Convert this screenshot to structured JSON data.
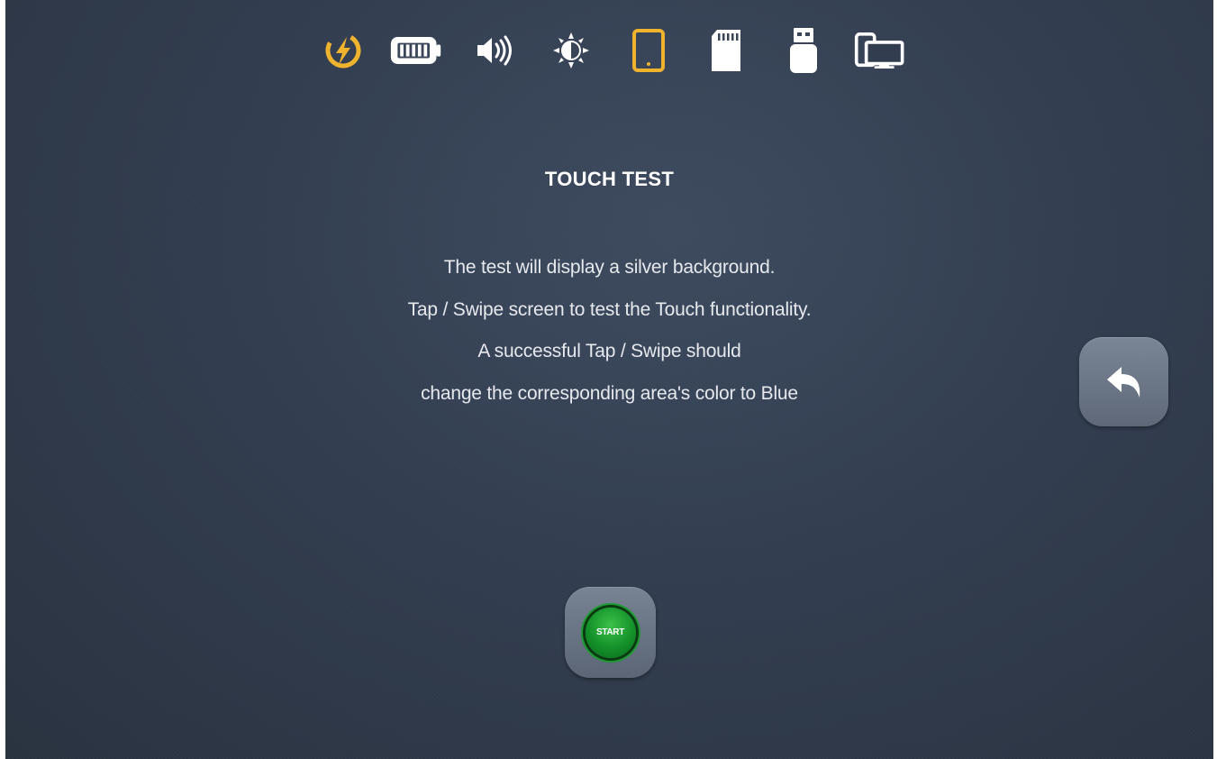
{
  "colors": {
    "accent": "#f0b32e",
    "icon": "#ffffff",
    "background": "#323d50",
    "start_green": "#14912a"
  },
  "toolbar": {
    "icons": [
      {
        "name": "power-icon",
        "active": true
      },
      {
        "name": "battery-icon",
        "active": false
      },
      {
        "name": "volume-icon",
        "active": false
      },
      {
        "name": "brightness-icon",
        "active": false
      },
      {
        "name": "tablet-touch-icon",
        "active": true
      },
      {
        "name": "sd-card-icon",
        "active": false
      },
      {
        "name": "usb-icon",
        "active": false
      },
      {
        "name": "display-output-icon",
        "active": false
      }
    ]
  },
  "main": {
    "title": "TOUCH TEST",
    "lines": [
      "The test will display a silver background.",
      "Tap / Swipe screen to test the Touch functionality.",
      "A successful Tap / Swipe should",
      "change the corresponding area's color to Blue"
    ]
  },
  "back_button": {
    "icon": "back-arrow-icon"
  },
  "start_button": {
    "label": "START"
  }
}
